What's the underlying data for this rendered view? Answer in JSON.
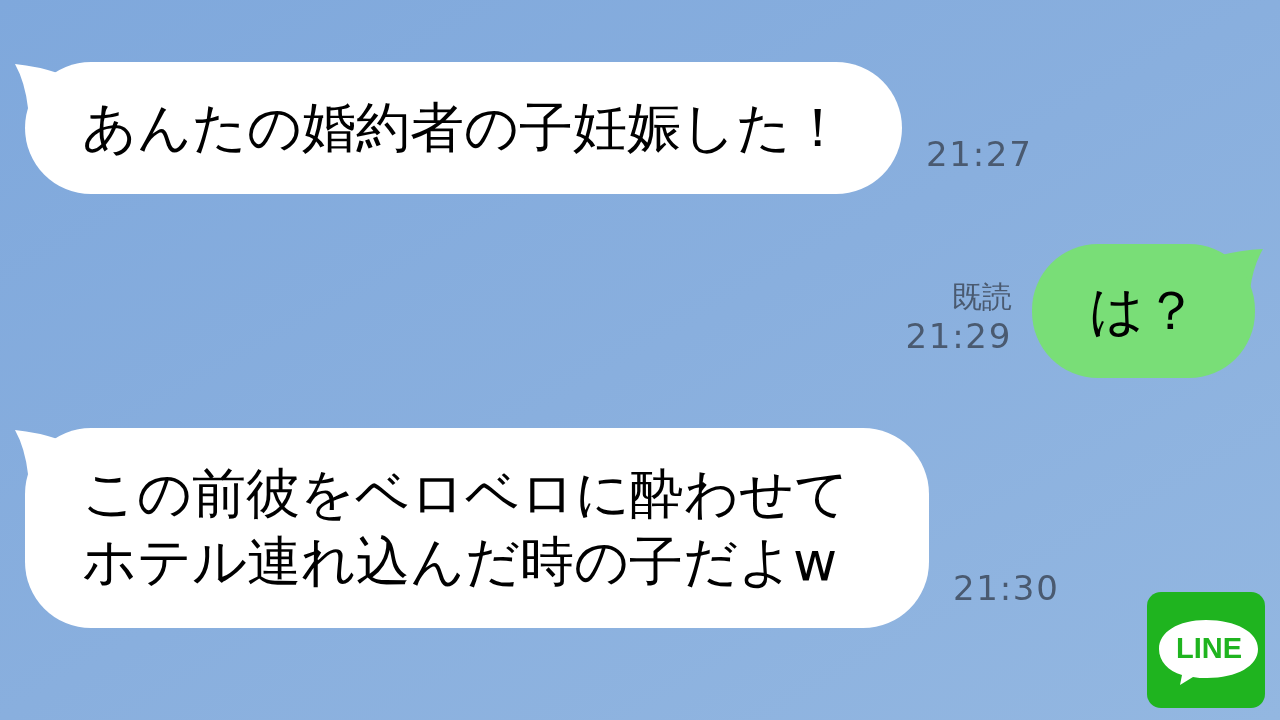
{
  "messages": [
    {
      "kind": "incoming",
      "text": "あんたの婚約者の子妊娠した！",
      "time": "21:27"
    },
    {
      "kind": "outgoing",
      "read_label": "既読",
      "text": "は？",
      "time": "21:29"
    },
    {
      "kind": "incoming",
      "text": "この前彼をベロベロに酔わせてホテル連れ込んだ時の子だよw",
      "time": "21:30"
    }
  ],
  "logo": {
    "text": "LINE"
  }
}
